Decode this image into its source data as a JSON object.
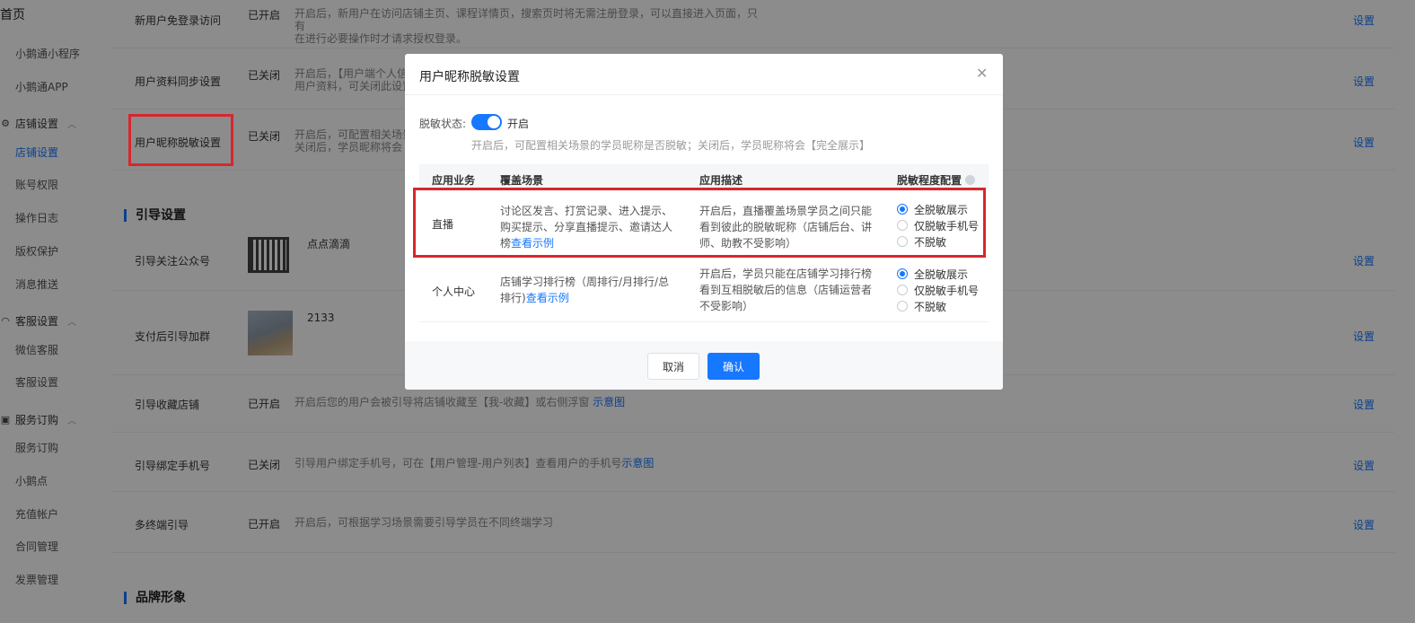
{
  "sidebar": {
    "home": "首页",
    "items_top": [
      "小鹅通小程序",
      "小鹅通APP"
    ],
    "group_store": {
      "label": "店铺设置",
      "icon": "gear-icon"
    },
    "items_store": [
      "店铺设置",
      "账号权限",
      "操作日志",
      "版权保护",
      "消息推送"
    ],
    "group_service": {
      "label": "客服设置",
      "icon": "headset-icon"
    },
    "items_service": [
      "微信客服",
      "客服设置"
    ],
    "group_order": {
      "label": "服务订购",
      "icon": "cart-icon"
    },
    "items_order": [
      "服务订购",
      "小鹅点",
      "充值帐户",
      "合同管理",
      "发票管理"
    ]
  },
  "settings": {
    "rows": [
      {
        "name": "新用户免登录访问",
        "status": "已开启",
        "desc_line1": "开启后，新用户在访问店铺主页、课程详情页，搜索页时将无需注册登录，可以直接进入页面，只有",
        "desc_line2": "在进行必要操作时才请求授权登录。",
        "action": "设置"
      },
      {
        "name": "用户资料同步设置",
        "status": "已关闭",
        "desc_line1": "开启后，【用户端个人信",
        "desc_line2": "用户资料，可关闭此设置",
        "action": "设置"
      },
      {
        "name": "用户昵称脱敏设置",
        "status": "已关闭",
        "desc_line1": "开启后，可配置相关场景",
        "desc_line2": "关闭后，学员昵称将会",
        "action": "设置"
      }
    ],
    "guide_section": "引导设置",
    "guide_rows": [
      {
        "name": "引导关注公众号",
        "img_label": "点点滴滴",
        "action": "设置"
      },
      {
        "name": "支付后引导加群",
        "img_label": "2133",
        "action": "设置"
      },
      {
        "name": "引导收藏店铺",
        "status": "已开启",
        "desc": "开启后您的用户会被引导将店铺收藏至【我-收藏】或右侧浮窗",
        "link": "示意图",
        "action": "设置"
      },
      {
        "name": "引导绑定手机号",
        "status": "已关闭",
        "desc": "引导用户绑定手机号，可在【用户管理-用户列表】查看用户的手机号",
        "link": "示意图",
        "action": "设置"
      },
      {
        "name": "多终端引导",
        "status": "已开启",
        "desc": "开启后，可根据学习场景需要引导学员在不同终端学习",
        "action": "设置"
      }
    ],
    "brand_section": "品牌形象"
  },
  "modal": {
    "title": "用户昵称脱敏设置",
    "close_icon": "close-icon",
    "status_label": "脱敏状态:",
    "toggle_on": true,
    "toggle_text": "开启",
    "status_hint": "开启后，可配置相关场景的学员昵称是否脱敏；关闭后，学员昵称将会【完全展示】",
    "columns": [
      "应用业务",
      "覆盖场景",
      "应用描述",
      "脱敏程度配置"
    ],
    "rows": [
      {
        "biz": "直播",
        "scene": "讨论区发言、打赏记录、进入提示、购买提示、分享直播提示、邀请达人榜",
        "scene_link": "查看示例",
        "desc": "开启后，直播覆盖场景学员之间只能看到彼此的脱敏昵称（店铺后台、讲师、助教不受影响）",
        "options": [
          "全脱敏展示",
          "仅脱敏手机号",
          "不脱敏"
        ],
        "selected": 0
      },
      {
        "biz": "个人中心",
        "scene": "店铺学习排行榜（周排行/月排行/总排行)",
        "scene_link": "查看示例",
        "desc": "开启后，学员只能在店铺学习排行榜看到互相脱敏后的信息（店铺运营者不受影响）",
        "options": [
          "全脱敏展示",
          "仅脱敏手机号",
          "不脱敏"
        ],
        "selected": 0
      }
    ],
    "cancel": "取消",
    "confirm": "确认"
  },
  "colors": {
    "accent": "#1677ff",
    "highlight": "#d9262c"
  }
}
